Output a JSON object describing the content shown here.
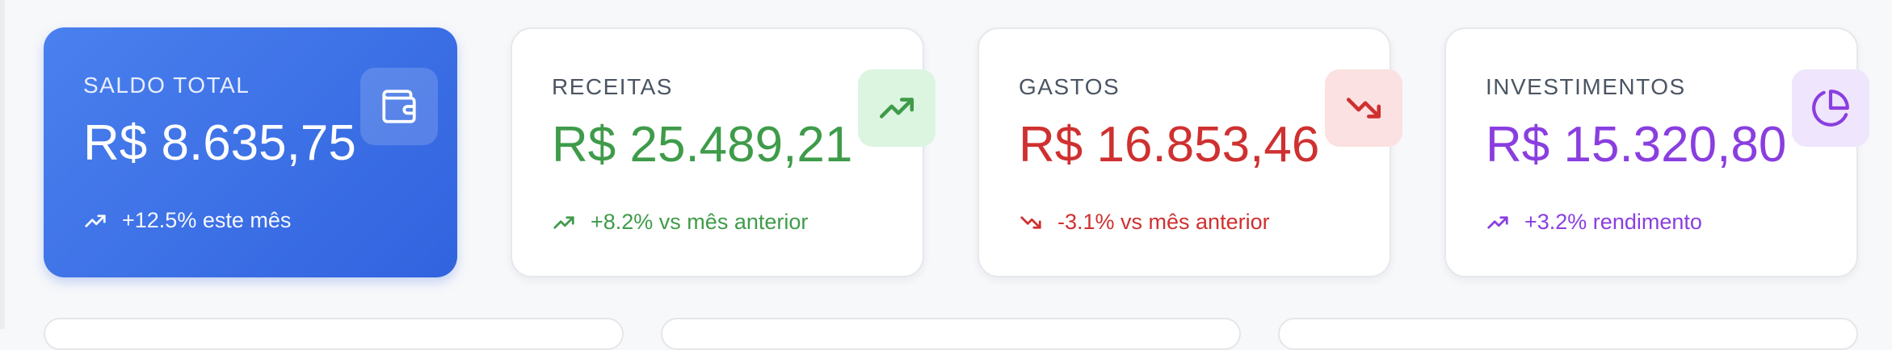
{
  "cards": [
    {
      "label": "SALDO TOTAL",
      "value": "R$ 8.635,75",
      "trend": "+12.5% este mês",
      "icon": "wallet-icon",
      "trend_icon": "trending-up-icon",
      "color": "#3b6ee6"
    },
    {
      "label": "RECEITAS",
      "value": "R$ 25.489,21",
      "trend": "+8.2% vs mês anterior",
      "icon": "trending-up-icon",
      "trend_icon": "trending-up-icon",
      "color": "#3f9b4a"
    },
    {
      "label": "GASTOS",
      "value": "R$ 16.853,46",
      "trend": "-3.1% vs mês anterior",
      "icon": "trending-down-icon",
      "trend_icon": "trending-down-icon",
      "color": "#cf3030"
    },
    {
      "label": "INVESTIMENTOS",
      "value": "R$ 15.320,80",
      "trend": "+3.2% rendimento",
      "icon": "pie-chart-icon",
      "trend_icon": "trending-up-icon",
      "color": "#8a3ee0"
    }
  ]
}
